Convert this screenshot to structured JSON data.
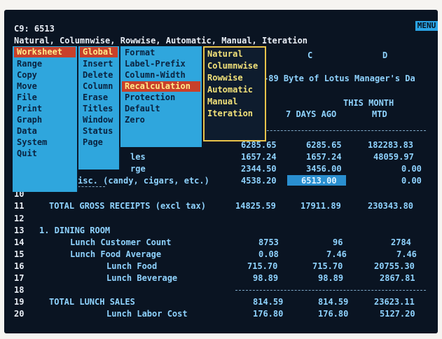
{
  "cell": {
    "address": "C9: 6513"
  },
  "prompt": "Natural, Columnwise, Rowwise, Automatic, Manual, Iteration",
  "mode_indicator": "MENU",
  "menus": {
    "main": [
      "Worksheet",
      "Range",
      "Copy",
      "Move",
      "File",
      "Print",
      "Graph",
      "Data",
      "System",
      "Quit"
    ],
    "global": [
      "Global",
      "Insert",
      "Delete",
      "Column",
      "Erase",
      "Titles",
      "Window",
      "Status",
      "Page"
    ],
    "global_sub": [
      "Format",
      "Label-Prefix",
      "Column-Width",
      "Recalculation",
      "Protection",
      "Default",
      "Zero"
    ],
    "recalc": [
      "Natural",
      "Columnwise",
      "Rowwise",
      "Automatic",
      "Manual",
      "Iteration"
    ]
  },
  "headers": {
    "col_c": "C",
    "col_d": "D",
    "banner": "-89 Byte of Lotus Manager's Da",
    "this_month": "THIS MONTH",
    "days_ago": "7 DAYS AGO",
    "mtd": "MTD"
  },
  "rows": [
    {
      "num": "",
      "label": "",
      "b": "6285.65",
      "c": "6285.65",
      "d": "182283.83"
    },
    {
      "num": "",
      "label": "les",
      "b": "1657.24",
      "c": "1657.24",
      "d": "48059.97"
    },
    {
      "num": "",
      "label": "rge",
      "b": "2344.50",
      "c": "3456.00",
      "d": "0.00"
    },
    {
      "num": "",
      "label": "isc. (candy, cigars, etc.)",
      "b": "4538.20",
      "c": "6513.00",
      "d": "0.00"
    },
    {
      "num": "10",
      "label": "",
      "b": "",
      "c": "",
      "d": ""
    },
    {
      "num": "11",
      "label": "TOTAL GROSS RECEIPTS (excl tax)",
      "b": "14825.59",
      "c": "17911.89",
      "d": "230343.80"
    },
    {
      "num": "12",
      "label": "",
      "b": "",
      "c": "",
      "d": ""
    },
    {
      "num": "13",
      "label": "1. DINING ROOM",
      "b": "",
      "c": "",
      "d": ""
    },
    {
      "num": "14",
      "label": "Lunch Customer Count",
      "b": "8753",
      "c": "96",
      "d": "2784"
    },
    {
      "num": "15",
      "label": "Lunch Food Average",
      "b": "0.08",
      "c": "7.46",
      "d": "7.46"
    },
    {
      "num": "16",
      "label": "Lunch Food",
      "b": "715.70",
      "c": "715.70",
      "d": "20755.30"
    },
    {
      "num": "17",
      "label": "Lunch Beverage",
      "b": "98.89",
      "c": "98.89",
      "d": "2867.81"
    },
    {
      "num": "18",
      "label": "",
      "b": "",
      "c": "",
      "d": ""
    },
    {
      "num": "19",
      "label": "TOTAL LUNCH SALES",
      "b": "814.59",
      "c": "814.59",
      "d": "23623.11"
    },
    {
      "num": "20",
      "label": "Lunch Labor Cost",
      "b": "176.80",
      "c": "176.80",
      "d": "5127.20"
    }
  ],
  "colors": {
    "screen": "#0a1422",
    "menu": "#2fa6dd",
    "highlight": "#c8402a",
    "natural_border": "#e9c34a"
  }
}
